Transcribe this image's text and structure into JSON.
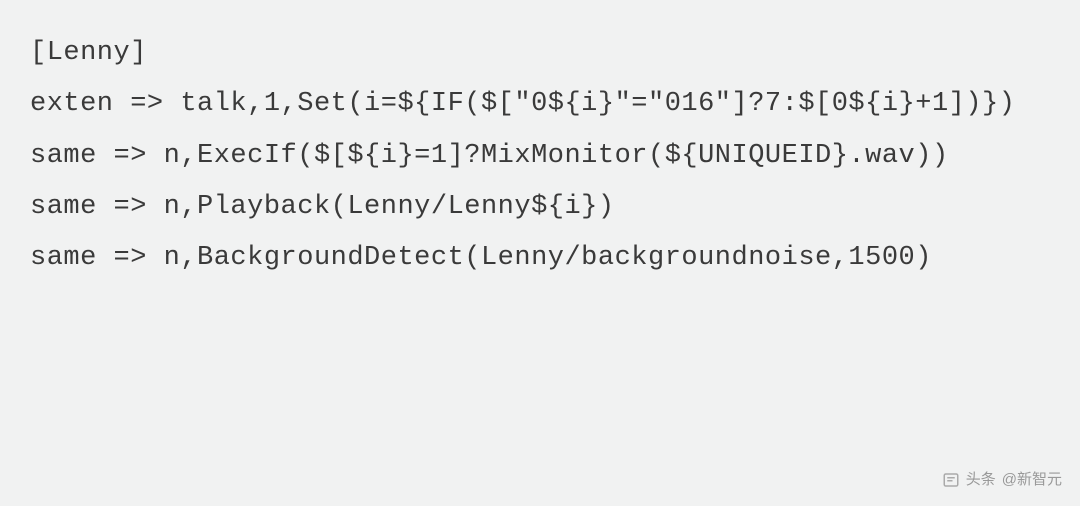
{
  "code": {
    "lines": [
      "[Lenny]",
      "exten => talk,1,Set(i=${IF($[\"0${i}\"=\"016\"]?7:$[0${i}+1])})",
      "same => n,ExecIf($[${i}=1]?MixMonitor(${UNIQUEID}.wav))",
      "same => n,Playback(Lenny/Lenny${i})",
      "same => n,BackgroundDetect(Lenny/backgroundnoise,1500)"
    ]
  },
  "watermark": {
    "prefix": "头条",
    "account": "@新智元"
  }
}
